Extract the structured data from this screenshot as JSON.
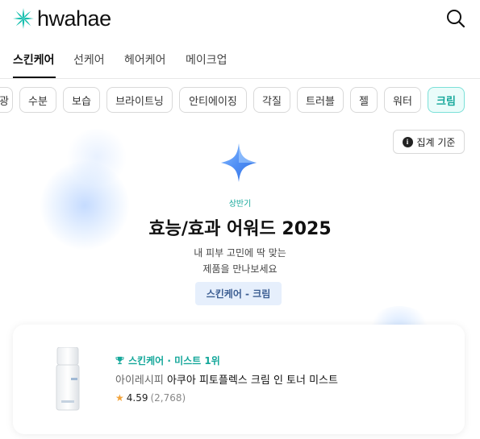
{
  "header": {
    "logo_text": "hwahae",
    "search_icon": "search-icon",
    "logo_icon": "sparkle-logo-icon"
  },
  "tabs": [
    {
      "label": "스킨케어",
      "active": true
    },
    {
      "label": "선케어",
      "active": false
    },
    {
      "label": "헤어케어",
      "active": false
    },
    {
      "label": "메이크업",
      "active": false
    }
  ],
  "chips": [
    {
      "label": "광",
      "active": false
    },
    {
      "label": "수분",
      "active": false
    },
    {
      "label": "보습",
      "active": false
    },
    {
      "label": "브라이트닝",
      "active": false
    },
    {
      "label": "안티에이징",
      "active": false
    },
    {
      "label": "각질",
      "active": false
    },
    {
      "label": "트러블",
      "active": false
    },
    {
      "label": "젤",
      "active": false
    },
    {
      "label": "워터",
      "active": false
    },
    {
      "label": "크림",
      "active": true
    }
  ],
  "criteria_button": {
    "label": "집계 기준",
    "icon": "info-icon"
  },
  "award": {
    "icon": "star-award-icon",
    "period": "상반기",
    "title": "효능/효과 어워드 2025",
    "subtitle_line1": "내 피부 고민에 딱 맞는",
    "subtitle_line2": "제품을 만나보세요",
    "category_badge": "스킨케어 - 크림"
  },
  "product": {
    "rank_label": "스킨케어 · 미스트 1위",
    "brand": "아이레시피",
    "name": "아쿠아 피토플렉스 크림 인 토너 미스트",
    "rating": "4.59",
    "review_count": "(2,768)",
    "icons": {
      "trophy": "trophy-icon",
      "star": "star-icon"
    }
  },
  "colors": {
    "accent": "#14a79a",
    "badge_bg": "#e6effc",
    "badge_text": "#3c5e92",
    "star": "#f2a33a"
  }
}
